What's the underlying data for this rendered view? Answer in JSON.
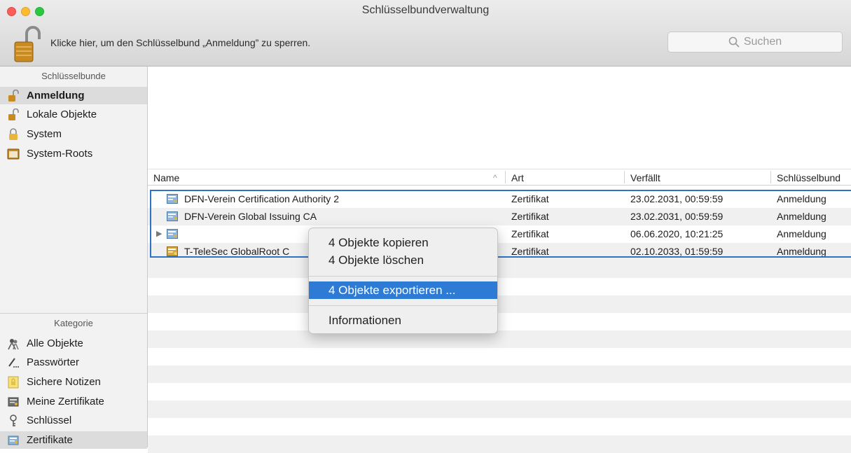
{
  "window": {
    "title": "Schlüsselbundverwaltung"
  },
  "toolbar": {
    "lock_text": "Klicke hier, um den Schlüsselbund „Anmeldung” zu sperren.",
    "search_placeholder": "Suchen",
    "icons": {
      "lock": "unlocked-padlock-icon",
      "search": "magnifier-icon"
    }
  },
  "sidebar": {
    "keychains_header": "Schlüsselbunde",
    "keychains": [
      {
        "label": "Anmeldung",
        "icon": "unlocked-padlock-icon",
        "selected": true
      },
      {
        "label": "Lokale Objekte",
        "icon": "unlocked-padlock-icon",
        "selected": false
      },
      {
        "label": "System",
        "icon": "locked-padlock-icon",
        "selected": false
      },
      {
        "label": "System-Roots",
        "icon": "folder-cabinet-icon",
        "selected": false
      }
    ],
    "category_header": "Kategorie",
    "categories": [
      {
        "label": "Alle Objekte",
        "icon": "people-icon",
        "selected": false
      },
      {
        "label": "Passwörter",
        "icon": "pen-dots-icon",
        "selected": false
      },
      {
        "label": "Sichere Notizen",
        "icon": "secure-note-icon",
        "selected": false
      },
      {
        "label": "Meine Zertifikate",
        "icon": "my-certificate-icon",
        "selected": false
      },
      {
        "label": "Schlüssel",
        "icon": "key-icon",
        "selected": false
      },
      {
        "label": "Zertifikate",
        "icon": "certificate-icon",
        "selected": true
      }
    ]
  },
  "table": {
    "columns": [
      "Name",
      "Art",
      "Verfällt",
      "Schlüsselbund"
    ],
    "sort_indicator": "^",
    "rows": [
      {
        "name": "DFN-Verein Certification Authority 2",
        "art": "Zertifikat",
        "expires": "23.02.2031, 00:59:59",
        "keychain": "Anmeldung"
      },
      {
        "name": "DFN-Verein Global Issuing CA",
        "art": "Zertifikat",
        "expires": "23.02.2031, 00:59:59",
        "keychain": "Anmeldung"
      },
      {
        "name": "",
        "art": "Zertifikat",
        "expires": "06.06.2020, 10:21:25",
        "keychain": "Anmeldung"
      },
      {
        "name": "T-TeleSec GlobalRoot C",
        "art": "Zertifikat",
        "expires": "02.10.2033, 01:59:59",
        "keychain": "Anmeldung"
      }
    ]
  },
  "context_menu": {
    "items": [
      {
        "label": "4 Objekte kopieren"
      },
      {
        "label": "4 Objekte löschen"
      },
      {
        "label": "4 Objekte exportieren ..."
      },
      {
        "label": "Informationen"
      }
    ],
    "highlighted_index": 2
  },
  "colors": {
    "selection": "#2f73c5",
    "menu_highlight": "#2e7bd6"
  }
}
